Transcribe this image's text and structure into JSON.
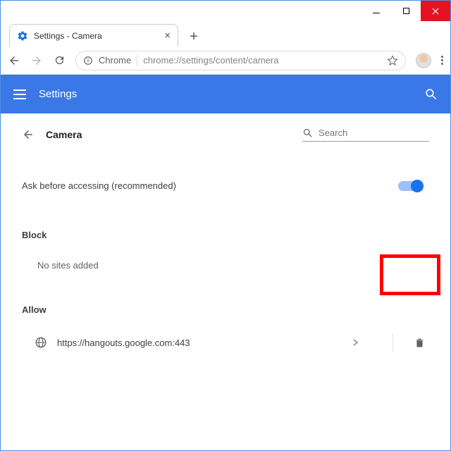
{
  "window": {
    "tab_title": "Settings - Camera"
  },
  "omnibox": {
    "origin_label": "Chrome",
    "url": "chrome://settings/content/camera"
  },
  "bluebar": {
    "title": "Settings"
  },
  "page": {
    "section": "Camera",
    "search_placeholder": "Search",
    "ask_label": "Ask before accessing (recommended)",
    "block_heading": "Block",
    "block_empty": "No sites added",
    "allow_heading": "Allow",
    "allow_sites": [
      {
        "url": "https://hangouts.google.com:443"
      }
    ]
  }
}
